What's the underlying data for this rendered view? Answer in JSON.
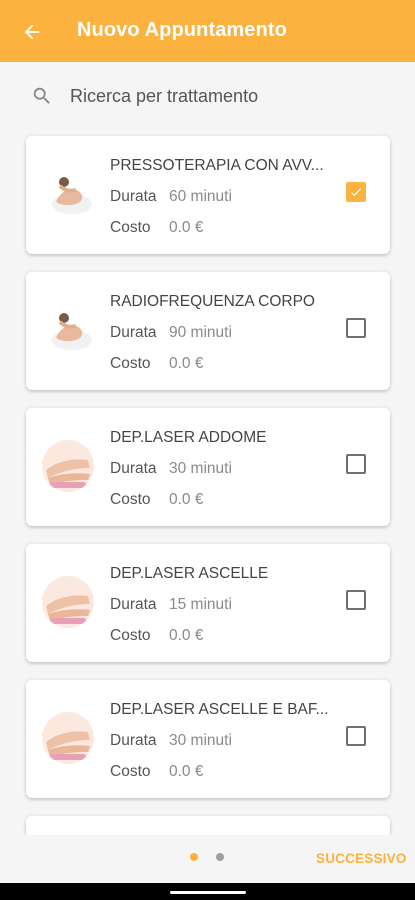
{
  "header": {
    "title": "Nuovo Appuntamento",
    "accent_color": "#fbb23e",
    "back_icon": "arrow-left-icon"
  },
  "search": {
    "placeholder": "Ricerca per trattamento",
    "value": "",
    "icon": "search-icon"
  },
  "treatments": [
    {
      "name": "PRESSOTERAPIA CON AVV...",
      "duration_label": "Durata",
      "duration": "60 minuti",
      "cost_label": "Costo",
      "cost": "0.0 €",
      "checked": true,
      "image": "body-treatment-image"
    },
    {
      "name": "RADIOFREQUENZA CORPO",
      "duration_label": "Durata",
      "duration": "90 minuti",
      "cost_label": "Costo",
      "cost": "0.0 €",
      "checked": false,
      "image": "body-treatment-image"
    },
    {
      "name": "DEP.LASER ADDOME",
      "duration_label": "Durata",
      "duration": "30 minuti",
      "cost_label": "Costo",
      "cost": "0.0 €",
      "checked": false,
      "image": "legs-treatment-image"
    },
    {
      "name": "DEP.LASER ASCELLE",
      "duration_label": "Durata",
      "duration": "15 minuti",
      "cost_label": "Costo",
      "cost": "0.0 €",
      "checked": false,
      "image": "legs-treatment-image"
    },
    {
      "name": "DEP.LASER ASCELLE E BAF...",
      "duration_label": "Durata",
      "duration": "30 minuti",
      "cost_label": "Costo",
      "cost": "0.0 €",
      "checked": false,
      "image": "legs-treatment-image"
    }
  ],
  "pager": {
    "active_color": "#fbb23e",
    "inactive_color": "#9e9e9e",
    "next_label": "SUCCESSIVO"
  }
}
